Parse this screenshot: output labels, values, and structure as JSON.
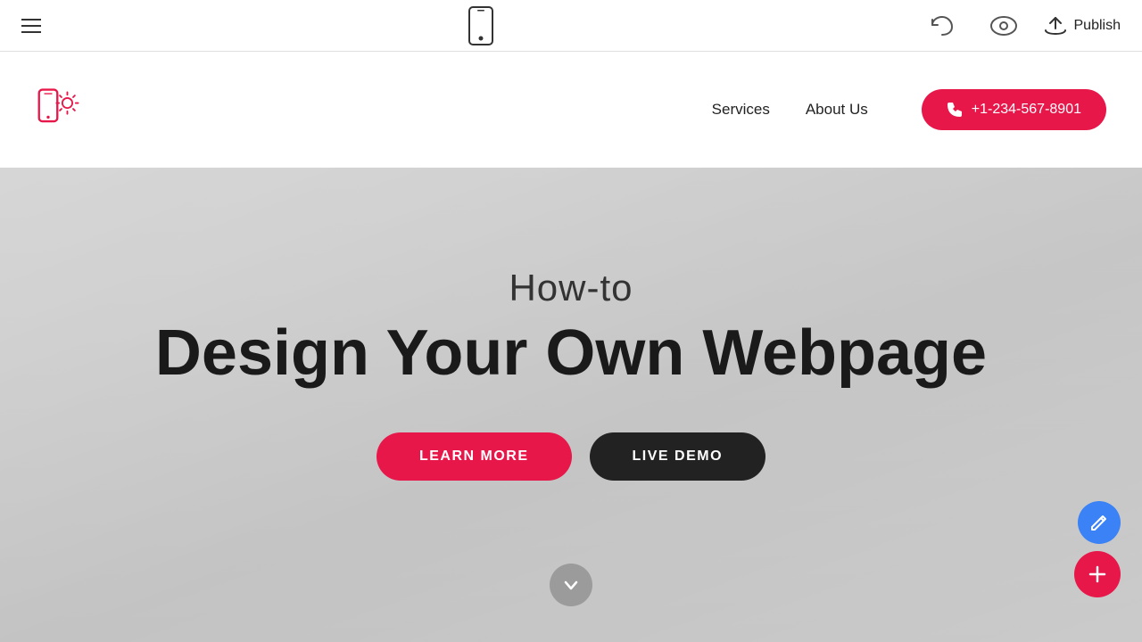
{
  "toolbar": {
    "publish_label": "Publish",
    "mobile_icon_label": "mobile-preview",
    "undo_icon_label": "undo",
    "eye_icon_label": "preview",
    "upload_icon_label": "upload"
  },
  "site_nav": {
    "nav_links": [
      {
        "label": "Services"
      },
      {
        "label": "About Us"
      }
    ],
    "phone_label": "+1-234-567-8901",
    "phone_icon": "📱"
  },
  "hero": {
    "subtitle": "How-to",
    "title": "Design Your Own Webpage",
    "learn_more_label": "LEARN MORE",
    "live_demo_label": "LIVE DEMO"
  },
  "colors": {
    "brand_red": "#e8174a",
    "dark": "#1a1a1a",
    "blue": "#3b82f6"
  }
}
